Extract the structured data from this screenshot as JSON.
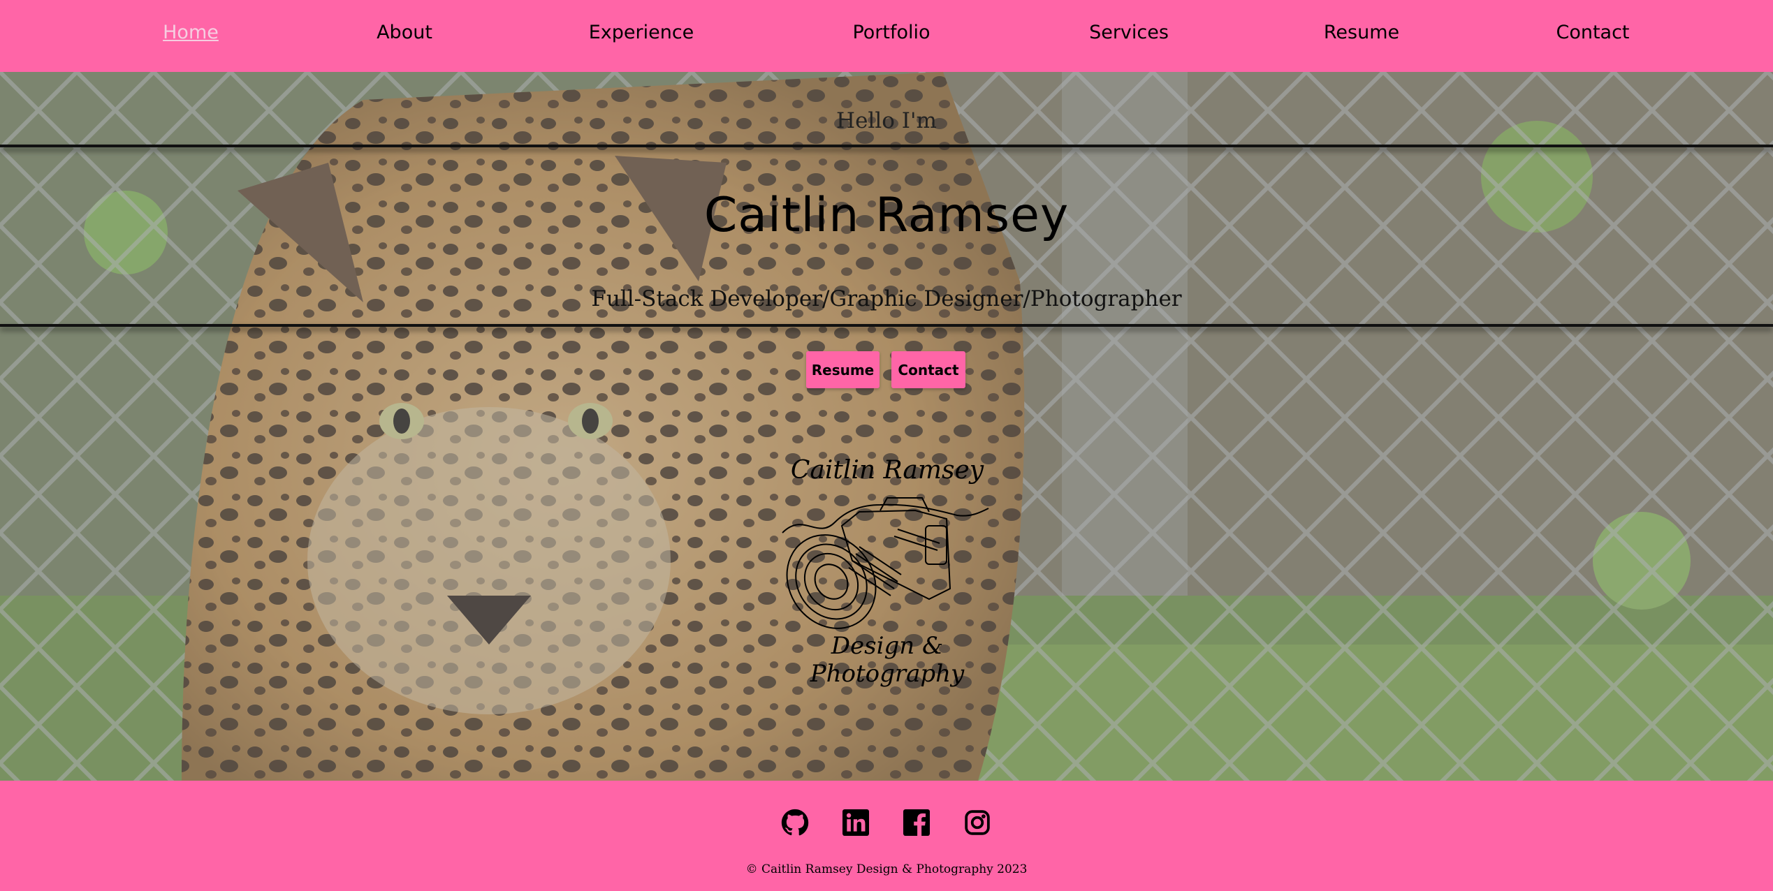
{
  "nav": {
    "items": [
      {
        "label": "Home",
        "active": true
      },
      {
        "label": "About"
      },
      {
        "label": "Experience"
      },
      {
        "label": "Portfolio"
      },
      {
        "label": "Services"
      },
      {
        "label": "Resume"
      },
      {
        "label": "Contact"
      }
    ]
  },
  "hero": {
    "greeting": "Hello I'm",
    "name": "Caitlin Ramsey",
    "roles": "Full-Stack Developer/Graphic Designer/Photographer",
    "background": "jaguar-photo",
    "buttons": {
      "resume": "Resume",
      "contact": "Contact"
    },
    "logo": {
      "top_text": "Caitlin Ramsey",
      "bottom_text": "Design & Photography",
      "icon": "camera-icon"
    }
  },
  "footer": {
    "social": [
      {
        "name": "github-icon"
      },
      {
        "name": "linkedin-icon"
      },
      {
        "name": "facebook-icon"
      },
      {
        "name": "instagram-icon"
      }
    ],
    "copyright": "© Caitlin Ramsey Design & Photography 2023"
  },
  "colors": {
    "accent": "#ff65a7",
    "active_nav": "#f6cde0",
    "text": "#000000"
  }
}
